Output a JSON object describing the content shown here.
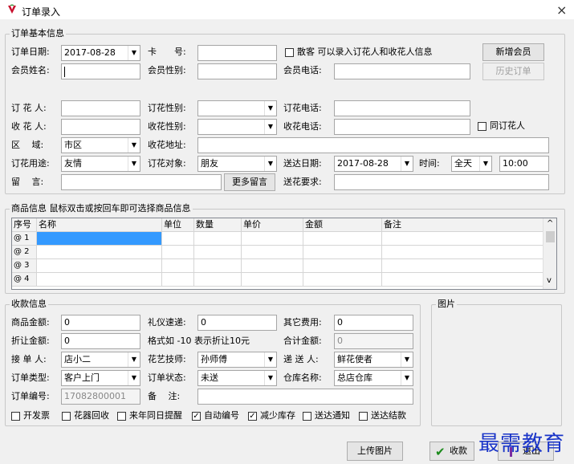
{
  "window": {
    "title": "订单录入",
    "close": "×"
  },
  "basic": {
    "legend": "订单基本信息",
    "order_date_label": "订单日期:",
    "order_date": "2017-08-28",
    "card_label": "卡　　号:",
    "card": "",
    "walkin_label": "散客 可以录入订花人和收花人信息",
    "new_member_btn": "新增会员",
    "member_name_label": "会员姓名:",
    "member_name": "",
    "member_gender_label": "会员性别:",
    "member_gender": "",
    "member_phone_label": "会员电话:",
    "member_phone": "",
    "history_btn": "历史订单",
    "orderer_label": "订 花 人:",
    "orderer": "",
    "orderer_gender_label": "订花性别:",
    "orderer_gender": "",
    "orderer_phone_label": "订花电话:",
    "orderer_phone": "",
    "receiver_label": "收 花 人:",
    "receiver": "",
    "receiver_gender_label": "收花性别:",
    "receiver_gender": "",
    "receiver_phone_label": "收花电话:",
    "receiver_phone": "",
    "same_label": "同订花人",
    "area_label": "区　 域:",
    "area": "市区",
    "address_label": "收花地址:",
    "address": "",
    "purpose_label": "订花用途:",
    "purpose": "友情",
    "target_label": "订花对象:",
    "target": "朋友",
    "deliver_date_label": "送达日期:",
    "deliver_date": "2017-08-28",
    "time_label": "时间:",
    "time_sel": "全天",
    "time_val": "10:00",
    "message_label": "留　 言:",
    "message": "",
    "more_msg_btn": "更多留言",
    "deliver_req_label": "送花要求:",
    "deliver_req": ""
  },
  "goods": {
    "legend": "商品信息 鼠标双击或按回车即可选择商品信息",
    "columns": [
      "序号",
      "名称",
      "单位",
      "数量",
      "单价",
      "金额",
      "备注"
    ],
    "rows": [
      "@ 1",
      "@ 2",
      "@ 3",
      "@ 4"
    ],
    "scroll_up": "^",
    "scroll_down": "v"
  },
  "payment": {
    "legend": "收款信息",
    "goods_amount_label": "商品金额:",
    "goods_amount": "0",
    "gift_fee_label": "礼仪速递:",
    "gift_fee": "0",
    "other_fee_label": "其它费用:",
    "other_fee": "0",
    "discount_label": "折让金额:",
    "discount": "0",
    "format_hint": "格式如 -10 表示折让10元",
    "total_label": "合计金额:",
    "total": "0",
    "receiver_staff_label": "接 单 人:",
    "receiver_staff": "店小二",
    "florist_label": "花艺技师:",
    "florist": "孙师傅",
    "courier_label": "递 送 人:",
    "courier": "鲜花使者",
    "order_type_label": "订单类型:",
    "order_type": "客户上门",
    "order_status_label": "订单状态:",
    "order_status": "未送",
    "warehouse_label": "仓库名称:",
    "warehouse": "总店仓库",
    "order_no_label": "订单编号:",
    "order_no": "17082800001",
    "note_label": "备　 注:",
    "note": "",
    "checks": [
      {
        "label": "开发票",
        "checked": false
      },
      {
        "label": "花器回收",
        "checked": false
      },
      {
        "label": "来年同日提醒",
        "checked": false
      },
      {
        "label": "自动编号",
        "checked": true
      },
      {
        "label": "减少库存",
        "checked": true
      },
      {
        "label": "送达通知",
        "checked": false
      },
      {
        "label": "送达结款",
        "checked": false
      }
    ]
  },
  "picture": {
    "legend": "图片"
  },
  "footer": {
    "upload_btn": "上传图片",
    "collect_btn": "收款",
    "exit_btn": "退出"
  },
  "watermark": "最需教育",
  "colors": {
    "selection": "#3399ff",
    "accent_check": "#1a8a1a",
    "watermark": "#1a35c8"
  },
  "dropdown_icon": "triangle-down-icon"
}
